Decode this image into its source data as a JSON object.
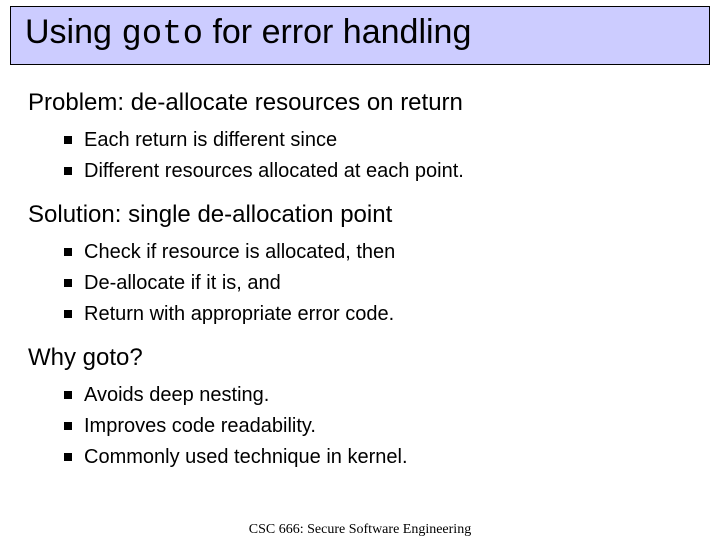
{
  "title": {
    "pre": "Using ",
    "mono": "goto",
    "post": " for error handling"
  },
  "sections": [
    {
      "heading": "Problem: de-allocate resources on return",
      "bullets": [
        "Each return is different since",
        "Different resources allocated at each point."
      ]
    },
    {
      "heading": "Solution: single de-allocation point",
      "bullets": [
        "Check if resource is allocated, then",
        "De-allocate if it is, and",
        "Return with appropriate error code."
      ]
    },
    {
      "heading": "Why goto?",
      "bullets": [
        "Avoids deep nesting.",
        "Improves code readability.",
        "Commonly used technique in kernel."
      ]
    }
  ],
  "footer": "CSC 666: Secure Software Engineering"
}
